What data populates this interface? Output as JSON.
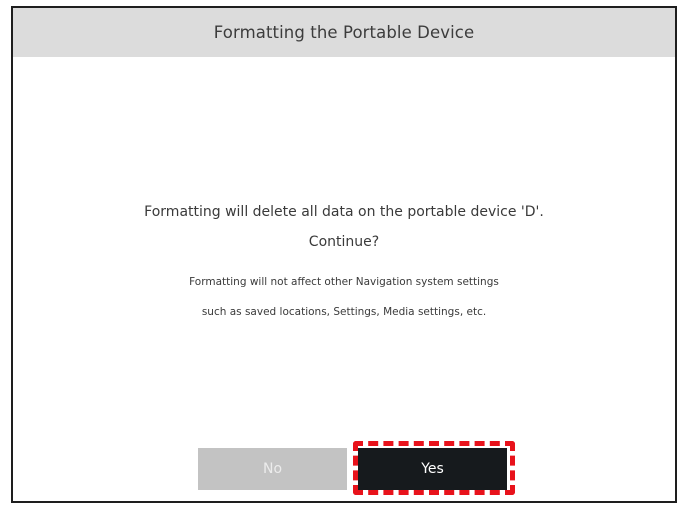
{
  "dialog": {
    "title": "Formatting the Portable Device",
    "message_line1": "Formatting will delete all data on the portable device 'D'.",
    "message_line2": "Continue?",
    "note_line1": "Formatting will not affect other Navigation system settings",
    "note_line2": "such as saved locations, Settings, Media settings, etc."
  },
  "buttons": {
    "no_label": "No",
    "yes_label": "Yes"
  },
  "colors": {
    "header_bg": "#dcdcdc",
    "no_button_bg": "#c3c3c3",
    "yes_button_bg": "#161a1d",
    "highlight": "#e8121b"
  }
}
